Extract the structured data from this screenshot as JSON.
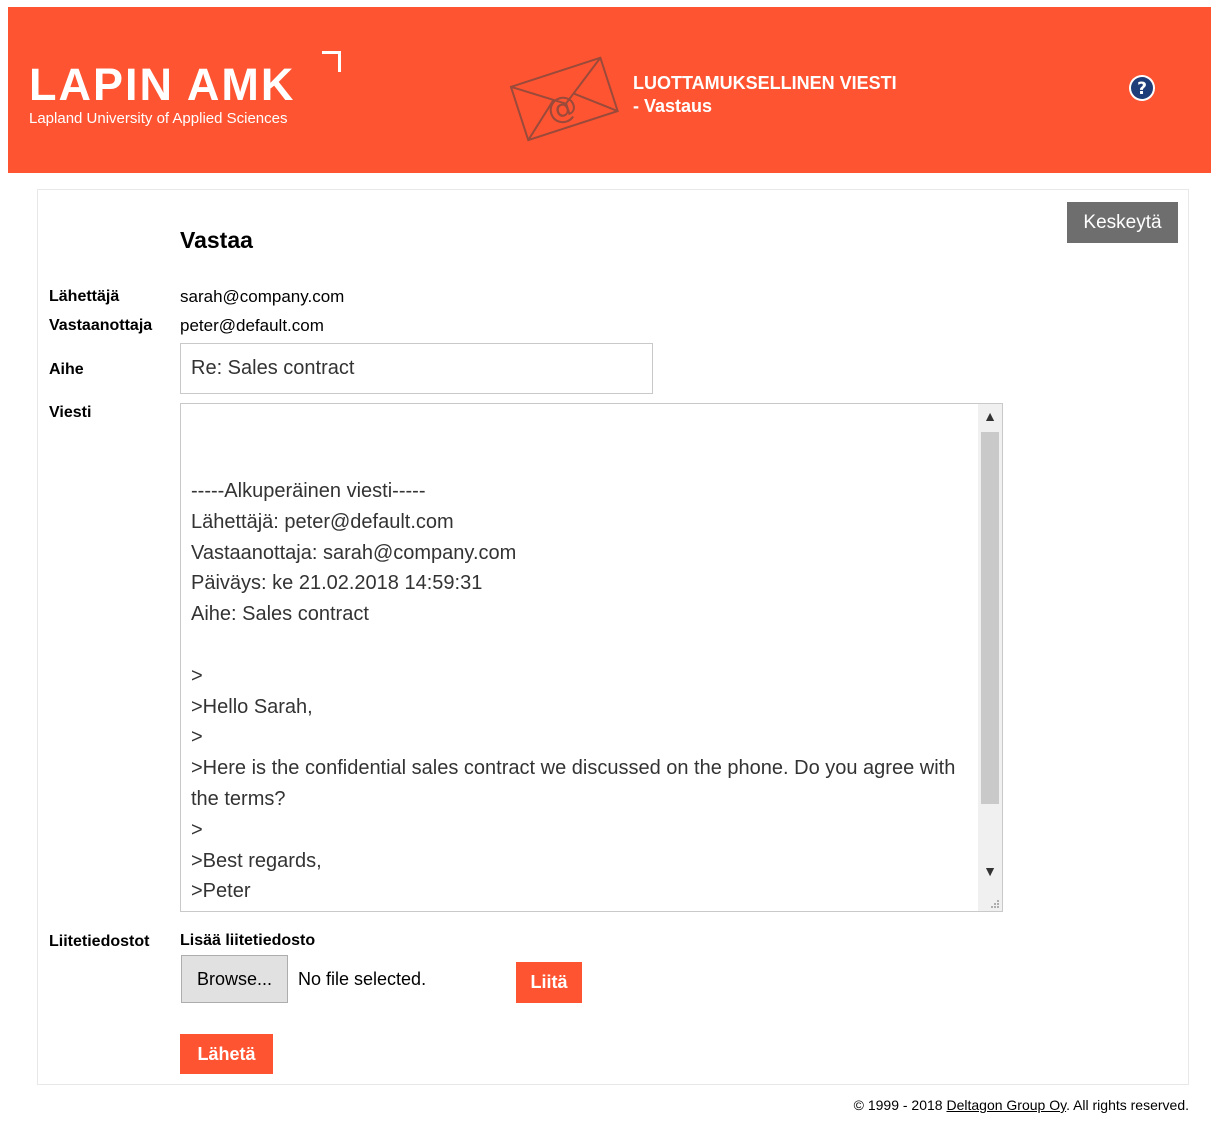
{
  "header": {
    "logo_text": "LAPIN AMK",
    "logo_subtitle": "Lapland University of Applied Sciences",
    "title_line1": "LUOTTAMUKSELLINEN VIESTI",
    "title_line2": "- Vastaus",
    "envelope_icon": "envelope-at-icon",
    "help_icon": "question-circle-icon",
    "brand_color": "#ff5431"
  },
  "form": {
    "heading": "Vastaa",
    "cancel_label": "Keskeytä",
    "sender_label": "Lähettäjä",
    "sender_value": "sarah@company.com",
    "recipient_label": "Vastaanottaja",
    "recipient_value": "peter@default.com",
    "subject_label": "Aihe",
    "subject_value": "Re: Sales contract",
    "message_label": "Viesti",
    "message_value": "-----Alkuperäinen viesti-----\nLähettäjä: peter@default.com\nVastaanottaja: sarah@company.com\nPäiväys: ke 21.02.2018 14:59:31\nAihe: Sales contract\n\n>\n>Hello Sarah,\n>\n>Here is the confidential sales contract we discussed on the phone. Do you agree with the terms?\n>\n>Best regards,\n>Peter",
    "attachments_label": "Liitetiedostot",
    "add_attachment_label": "Lisää liitetiedosto",
    "browse_label": "Browse...",
    "no_file_label": "No file selected.",
    "attach_label": "Liitä",
    "send_label": "Lähetä"
  },
  "footer": {
    "copyright_prefix": "© 1999 - 2018",
    "company_link": "Deltagon Group Oy",
    "copyright_suffix": ". All rights reserved."
  }
}
